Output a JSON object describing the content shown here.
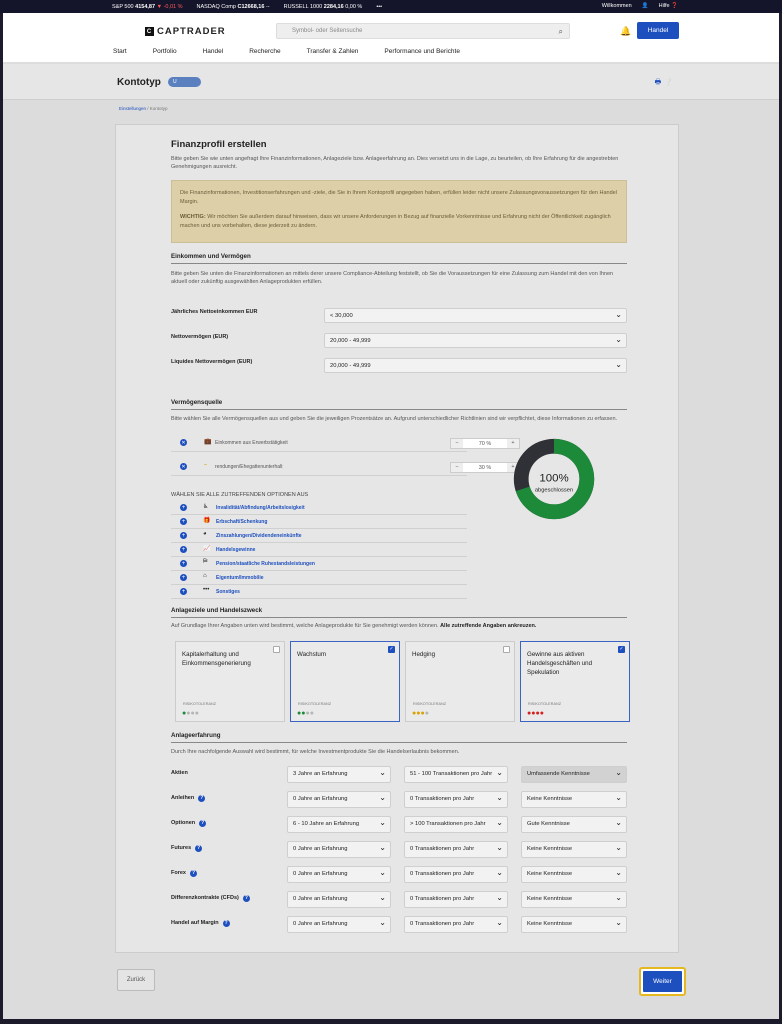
{
  "ticker": {
    "items": [
      {
        "name": "S&P 500",
        "value": "4154,87",
        "change": "▼ -0,01 %"
      },
      {
        "name": "NASDAQ Comp",
        "value": "C12668,16",
        "change": "--"
      },
      {
        "name": "RUSSELL 1000",
        "value": "2284,16",
        "change": "0,00 %"
      }
    ],
    "more": "•••",
    "welcome": "Willkommen",
    "help": "Hilfe"
  },
  "header": {
    "logo": "CAPTRADER",
    "search_placeholder": "Symbol- oder Seitensuche",
    "trade_button": "Handel",
    "nav": [
      "Start",
      "Portfolio",
      "Handel",
      "Recherche",
      "Transfer & Zahlen",
      "Performance und Berichte"
    ]
  },
  "page": {
    "title": "Kontotyp",
    "badge": "U",
    "breadcrumb": [
      "Einstellungen",
      "Kontotyp"
    ]
  },
  "form": {
    "title": "Finanzprofil erstellen",
    "intro": "Bitte geben Sie wie unten angefragt Ihre Finanzinformationen, Anlageziele bzw. Anlageerfahrung an. Dies versetzt uns in die Lage, zu beurteilen, ob Ihre Erfahrung für die angestrebten Genehmigungen ausreicht.",
    "warning1": "Die Finanzinformationen, Investitionserfahrungen und -ziele, die Sie in Ihrem Kontoprofil angegeben haben, erfüllen leider nicht unsere Zulassungsvoraussetzungen für den Handel Margin.",
    "warning2_bold": "WICHTIG:",
    "warning2": " Wir möchten Sie außerdem darauf hinweisen, dass wir unsere Anforderungen in Bezug auf finanzielle Vorkenntnisse und Erfahrung nicht der Öffentlichkeit zugänglich machen und uns vorbehalten, diese jederzeit zu ändern.",
    "income": {
      "title": "Einkommen und Vermögen",
      "desc": "Bitte geben Sie unten die Finanzinformationen an mittels derer unsere Compliance-Abteilung feststellt, ob Sie die Voraussetzungen für eine Zulassung zum Handel mit den von Ihnen aktuell oder zukünftig ausgewählten Anlageprodukten erfüllen.",
      "fields": [
        {
          "label": "Jährliches Nettoeinkommen EUR",
          "value": "< 30,000"
        },
        {
          "label": "Nettovermögen (EUR)",
          "value": "20,000 - 49,999"
        },
        {
          "label": "Liquides Nettovermögen (EUR)",
          "value": "20,000 - 49,999"
        }
      ]
    },
    "sources": {
      "title": "Vermögensquelle",
      "desc": "Bitte wählen Sie alle Vermögensquellen aus und geben Sie die jeweiligen Prozentsätze an. Aufgrund unterschiedlicher Richtlinien sind wir verpflichtet, diese Informationen zu erfassen.",
      "selected": [
        {
          "label": "Einkommen aus Erwerbstätigkeit",
          "percent": "70 %",
          "color": "#1d8a3a"
        },
        {
          "label": "rendungen/Ehegattenunterhalt",
          "percent": "30 %",
          "color": "#2f3136"
        }
      ],
      "donut_percent": "100%",
      "donut_label": "abgeschlossen",
      "all_title": "WÄHLEN SIE ALLE ZUTREFFENDEN OPTIONEN AUS",
      "options": [
        {
          "label": "Invalidität/Abfindung/Arbeitslosigkeit",
          "icon": "disability-icon"
        },
        {
          "label": "Erbschaft/Schenkung",
          "icon": "gift-icon"
        },
        {
          "label": "Zinszahlungen/Dividendeneinkünfte",
          "icon": "pie-icon"
        },
        {
          "label": "Handelsgewinne",
          "icon": "chart-icon"
        },
        {
          "label": "Pension/staatliche Ruhestandsleistungen",
          "icon": "sign-icon"
        },
        {
          "label": "Eigentum/Immobilie",
          "icon": "house-icon"
        },
        {
          "label": "Sonstiges",
          "icon": "more-icon"
        }
      ]
    },
    "goals": {
      "title": "Anlageziele und Handelszweck",
      "desc": "Auf Grundlage Ihrer Angaben unten wird bestimmt, welche Anlageprodukte für Sie genehmigt werden können.",
      "desc_bold": "Alle zutreffende Angaben ankreuzen.",
      "risk_label": "RISIKOTOLERANZ",
      "cards": [
        {
          "label": "Kapitalerhaltung und Einkommensgenerierung",
          "checked": false,
          "risk_level": 1,
          "color": "#1d8a3a"
        },
        {
          "label": "Wachstum",
          "checked": true,
          "risk_level": 2,
          "color": "#1d8a3a"
        },
        {
          "label": "Hedging",
          "checked": false,
          "risk_level": 3,
          "color": "#d9a200"
        },
        {
          "label": "Gewinne aus aktiven Handelsgeschäften und Spekulation",
          "checked": true,
          "risk_level": 4,
          "color": "#d62020"
        }
      ]
    },
    "experience": {
      "title": "Anlageerfahrung",
      "desc": "Durch Ihre nachfolgende Auswahl wird bestimmt, für welche Investmentprodukte Sie die Handelserlaubnis bekommen.",
      "rows": [
        {
          "label": "Aktien",
          "years": "3 Jahre an Erfahrung",
          "trades": "51 - 100 Transaktionen pro Jahr",
          "knowledge": "Umfassende Kenntnisse",
          "help": false
        },
        {
          "label": "Anleihen",
          "years": "0 Jahre an Erfahrung",
          "trades": "0 Transaktionen pro Jahr",
          "knowledge": "Keine Kenntnisse",
          "help": true
        },
        {
          "label": "Optionen",
          "years": "6 - 10 Jahre an Erfahrung",
          "trades": "> 100 Transaktionen pro Jahr",
          "knowledge": "Gute Kenntnisse",
          "help": true
        },
        {
          "label": "Futures",
          "years": "0 Jahre an Erfahrung",
          "trades": "0 Transaktionen pro Jahr",
          "knowledge": "Keine Kenntnisse",
          "help": true
        },
        {
          "label": "Forex",
          "years": "0 Jahre an Erfahrung",
          "trades": "0 Transaktionen pro Jahr",
          "knowledge": "Keine Kenntnisse",
          "help": true
        },
        {
          "label": "Differenzkontrakte (CFDs)",
          "years": "0 Jahre an Erfahrung",
          "trades": "0 Transaktionen pro Jahr",
          "knowledge": "Keine Kenntnisse",
          "help": true
        },
        {
          "label": "Handel auf Margin",
          "years": "0 Jahre an Erfahrung",
          "trades": "0 Transaktionen pro Jahr",
          "knowledge": "Keine Kenntnisse",
          "help": true
        }
      ]
    },
    "back_button": "Zurück",
    "next_button": "Weiter"
  }
}
